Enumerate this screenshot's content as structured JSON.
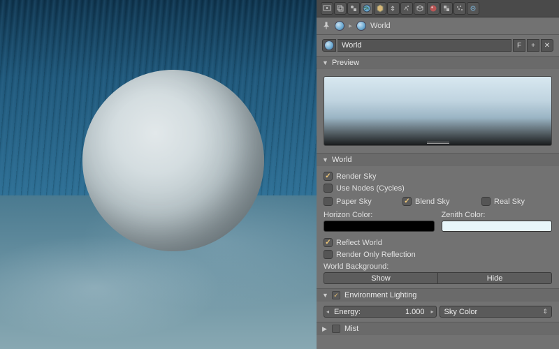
{
  "breadcrumb": {
    "context": "World"
  },
  "datablock": {
    "name": "World",
    "fake_btn": "F",
    "add_btn": "+",
    "del_btn": "✕"
  },
  "preview": {
    "title": "Preview"
  },
  "world": {
    "title": "World",
    "render_sky": "Render Sky",
    "use_nodes": "Use Nodes (Cycles)",
    "paper_sky": "Paper Sky",
    "blend_sky": "Blend Sky",
    "real_sky": "Real Sky",
    "horizon_label": "Horizon Color:",
    "zenith_label": "Zenith Color:",
    "horizon_color": "#000000",
    "zenith_color": "#e8f6fa",
    "reflect_world": "Reflect World",
    "render_only_reflection": "Render Only Reflection",
    "bg_label": "World Background:",
    "show": "Show",
    "hide": "Hide"
  },
  "env": {
    "title": "Environment Lighting",
    "energy_label": "Energy:",
    "energy_value": "1.000",
    "source": "Sky Color"
  },
  "mist": {
    "title": "Mist"
  }
}
